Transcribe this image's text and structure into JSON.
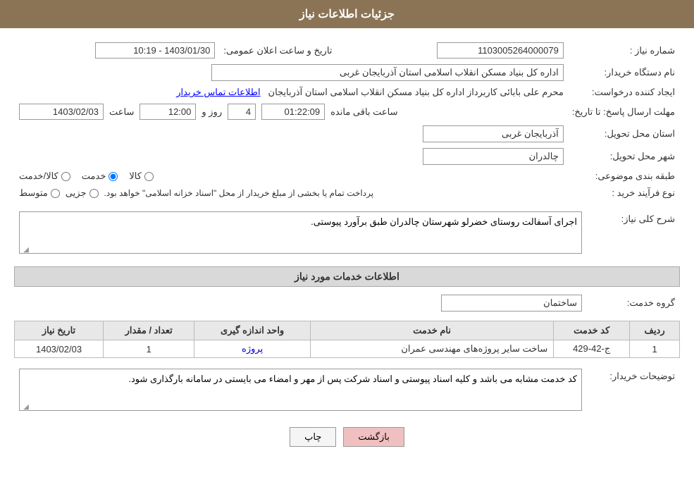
{
  "page": {
    "title": "جزئیات اطلاعات نیاز",
    "header_bg": "#8B7355"
  },
  "fields": {
    "shomare_niaz_label": "شماره نیاز :",
    "shomare_niaz_value": "1103005264000079",
    "nam_dastgah_label": "نام دستگاه خریدار:",
    "nam_dastgah_value": "اداره کل بنیاد مسکن انقلاب اسلامی استان آذربایجان غربی",
    "ijad_konande_label": "ایجاد کننده درخواست:",
    "ijad_konande_value": "محرم علی بابائی کاربرداز اداره کل بنیاد مسکن انقلاب اسلامی استان آذربایجان",
    "ijad_konande_link": "اطلاعات تماس خریدار",
    "mohlat_ersal_label": "مهلت ارسال پاسخ: تا تاریخ:",
    "tarikh_value": "1403/02/03",
    "saat_label": "ساعت",
    "saat_value": "12:00",
    "rooz_label": "روز و",
    "rooz_value": "4",
    "baqi_label": "ساعت باقی مانده",
    "baqi_value": "01:22:09",
    "tarikh_saet_label": "تاریخ و ساعت اعلان عمومی:",
    "tarikh_saet_value": "1403/01/30 - 10:19",
    "ostan_tahvil_label": "استان محل تحویل:",
    "ostan_tahvil_value": "آذربایجان غربی",
    "shahr_tahvil_label": "شهر محل تحویل:",
    "shahr_tahvil_value": "چالدران",
    "tabaqeh_label": "طبقه بندی موضوعی:",
    "radio_kala": "کالا",
    "radio_khedmat": "خدمت",
    "radio_kala_khedmat": "کالا/خدمت",
    "radio_selected": "khedmat",
    "nooe_farayand_label": "نوع فرآیند خرید :",
    "radio_jozi": "جزیی",
    "radio_motovaset": "متوسط",
    "radio_farayand_text": "پرداخت تمام یا بخشی از مبلغ خریدار از محل \"اسناد خزانه اسلامی\" خواهد بود.",
    "sharh_koli_label": "شرح کلی نیاز:",
    "sharh_koli_value": "اجرای آسفالت روستای خضرلو شهرستان چالدران طبق برآورد پیوستی.",
    "khadamat_section": "اطلاعات خدمات مورد نیاز",
    "gorooh_khedmat_label": "گروه خدمت:",
    "gorooh_khedmat_value": "ساختمان",
    "table": {
      "headers": [
        "ردیف",
        "کد خدمت",
        "نام خدمت",
        "واحد اندازه گیری",
        "تعداد / مقدار",
        "تاریخ نیاز"
      ],
      "rows": [
        {
          "radif": "1",
          "kod_khedmat": "ج-42-429",
          "nam_khedmat": "ساخت سایر پروژه‌های مهندسی عمران",
          "vahed": "پروژه",
          "tedad": "1",
          "tarikh": "1403/02/03"
        }
      ]
    },
    "toseeh_label": "توضیحات خریدار:",
    "toseeh_value": "کد خدمت مشابه می باشد و کلیه اسناد پیوستی و اسناد شرکت پس از مهر و امضاء می بایستی در سامانه بارگذاری شود.",
    "btn_print": "چاپ",
    "btn_back": "بازگشت"
  }
}
